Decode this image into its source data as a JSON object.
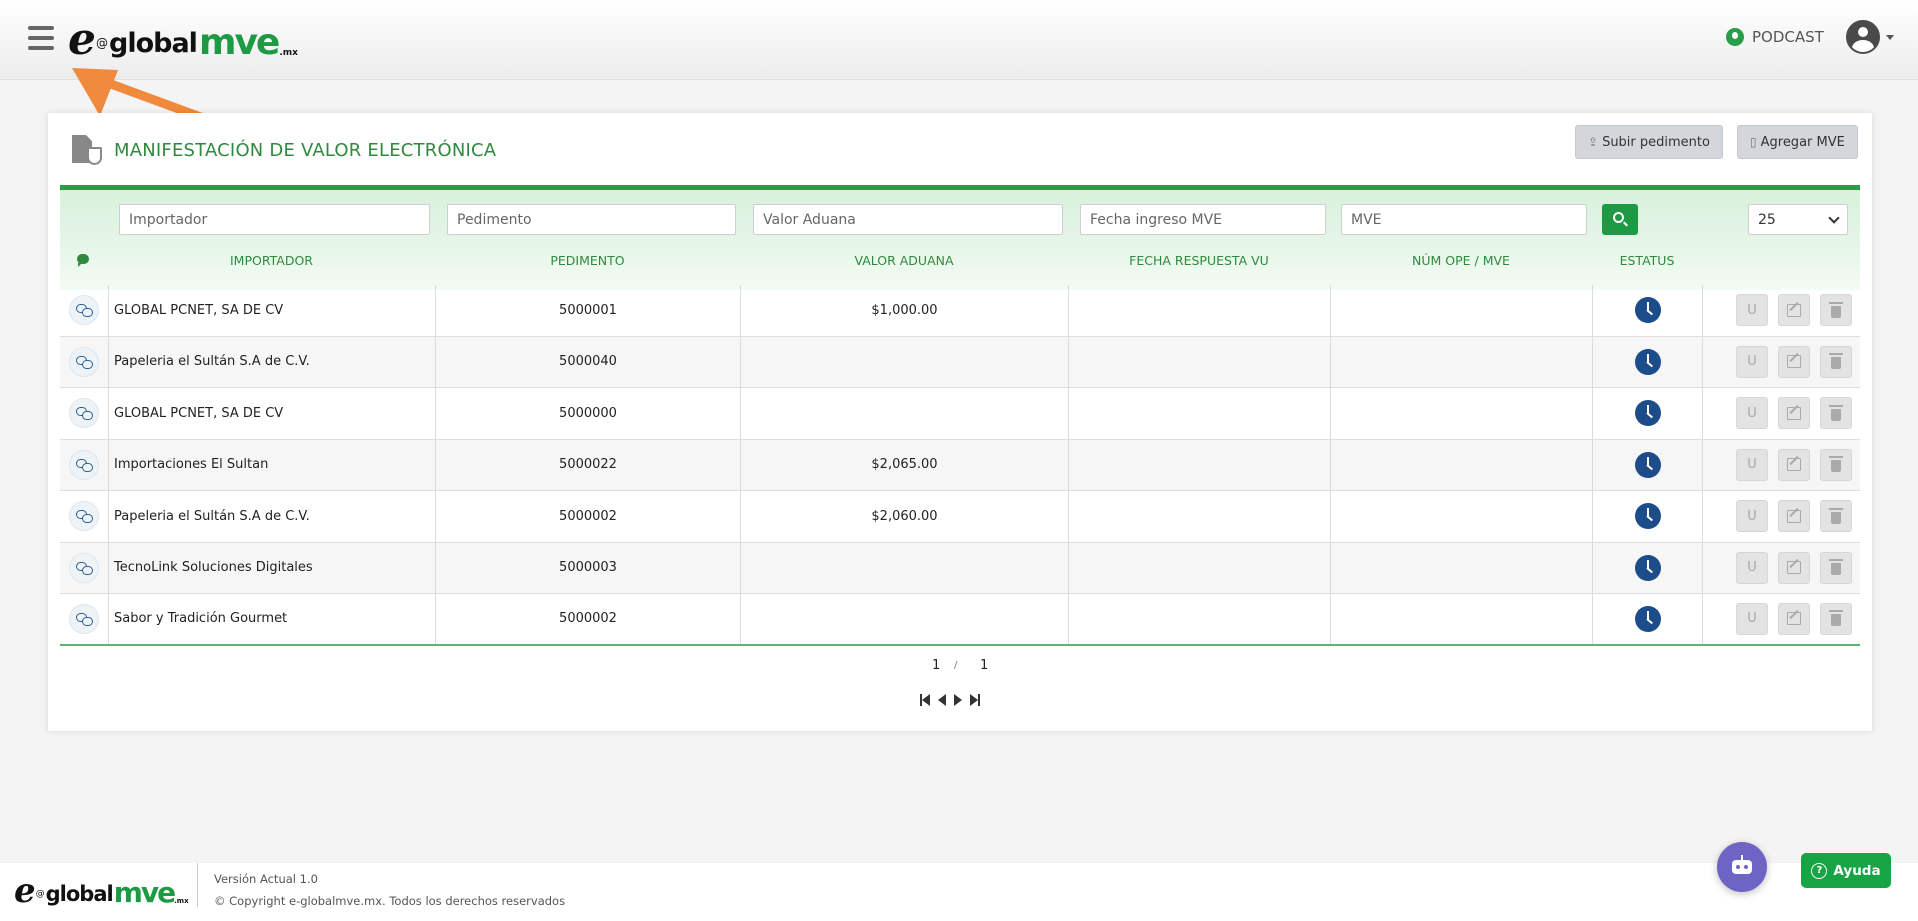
{
  "header": {
    "logo": {
      "e": "e",
      "at": "@",
      "global": "global",
      "mve": "mve",
      "mx": ".mx"
    },
    "podcast_label": "PODCAST"
  },
  "card": {
    "title": "MANIFESTACIÓN DE VALOR ELECTRÓNICA",
    "btn_subir": "Subir pedimento",
    "btn_agregar": "Agregar MVE"
  },
  "filters": {
    "importador": "Importador",
    "pedimento": "Pedimento",
    "valor_aduana": "Valor Aduana",
    "fecha_ingreso": "Fecha ingreso MVE",
    "mve": "MVE",
    "per_page": "25"
  },
  "columns": {
    "importador": "IMPORTADOR",
    "pedimento": "PEDIMENTO",
    "valor_aduana": "VALOR ADUANA",
    "fecha_respuesta": "FECHA RESPUESTA VU",
    "num_ope": "NÚM OPE / MVE",
    "estatus": "ESTATUS"
  },
  "rows": [
    {
      "importador": "GLOBAL PCNET, SA DE CV",
      "pedimento": "5000001",
      "valor_aduana": "$1,000.00",
      "fecha_respuesta": "",
      "num_ope": "",
      "action_u": "U"
    },
    {
      "importador": "Papeleria el Sultán S.A de C.V.",
      "pedimento": "5000040",
      "valor_aduana": "",
      "fecha_respuesta": "",
      "num_ope": "",
      "action_u": "U"
    },
    {
      "importador": "GLOBAL PCNET, SA DE CV",
      "pedimento": "5000000",
      "valor_aduana": "",
      "fecha_respuesta": "",
      "num_ope": "",
      "action_u": "U"
    },
    {
      "importador": "Importaciones El Sultan",
      "pedimento": "5000022",
      "valor_aduana": "$2,065.00",
      "fecha_respuesta": "",
      "num_ope": "",
      "action_u": "U"
    },
    {
      "importador": "Papeleria el Sultán S.A de C.V.",
      "pedimento": "5000002",
      "valor_aduana": "$2,060.00",
      "fecha_respuesta": "",
      "num_ope": "",
      "action_u": "U"
    },
    {
      "importador": "TecnoLink Soluciones Digitales",
      "pedimento": "5000003",
      "valor_aduana": "",
      "fecha_respuesta": "",
      "num_ope": "",
      "action_u": "U"
    },
    {
      "importador": "Sabor y Tradición Gourmet",
      "pedimento": "5000002",
      "valor_aduana": "",
      "fecha_respuesta": "",
      "num_ope": "",
      "action_u": "U"
    }
  ],
  "pagination": {
    "current": "1",
    "separator": "/",
    "total": "1"
  },
  "footer": {
    "logo": {
      "e": "e",
      "at": "@",
      "global": "global",
      "mve": "mve",
      "mx": ".mx"
    },
    "version": "Versión Actual 1.0",
    "copyright": "© Copyright e-globalmve.mx. Todos los derechos reservados"
  },
  "help_label": "Ayuda",
  "colors": {
    "brand_green": "#1f9a44",
    "status_blue": "#1c4c8a",
    "annotation_orange": "#f08a3c",
    "bot_purple": "#6e64c4"
  }
}
